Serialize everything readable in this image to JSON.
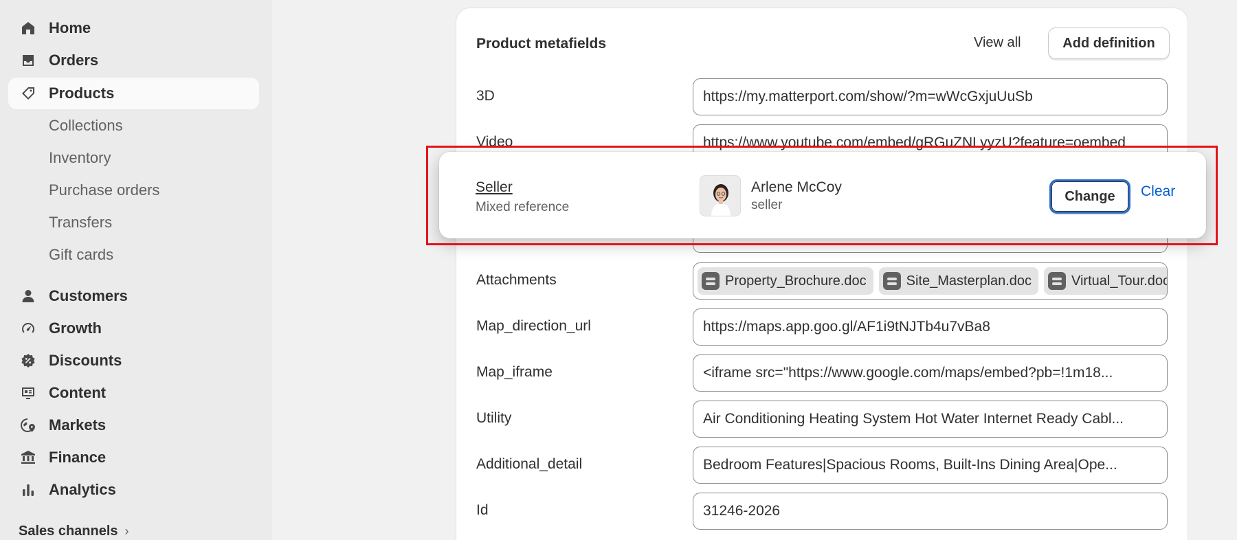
{
  "sidebar": {
    "items": [
      {
        "label": "Home",
        "icon": "home-icon"
      },
      {
        "label": "Orders",
        "icon": "inbox-icon"
      },
      {
        "label": "Products",
        "icon": "tag-icon",
        "active": true
      },
      {
        "label": "Collections"
      },
      {
        "label": "Inventory"
      },
      {
        "label": "Purchase orders"
      },
      {
        "label": "Transfers"
      },
      {
        "label": "Gift cards"
      },
      {
        "label": "Customers",
        "icon": "person-icon"
      },
      {
        "label": "Growth",
        "icon": "gauge-icon"
      },
      {
        "label": "Discounts",
        "icon": "discount-icon"
      },
      {
        "label": "Content",
        "icon": "content-icon"
      },
      {
        "label": "Markets",
        "icon": "globe-icon"
      },
      {
        "label": "Finance",
        "icon": "bank-icon"
      },
      {
        "label": "Analytics",
        "icon": "bar-chart-icon"
      }
    ],
    "sales_channels": "Sales channels"
  },
  "metafields": {
    "title": "Product metafields",
    "view_all": "View all",
    "add_definition": "Add definition",
    "fields": [
      {
        "label": "3D",
        "value": "https://my.matterport.com/show/?m=wWcGxjuUuSb"
      },
      {
        "label": "Video",
        "value": "https://www.youtube.com/embed/gRGuZNLyyzU?feature=oembed"
      },
      {
        "label": "Attachments",
        "attachments": [
          "Property_Brochure.doc",
          "Site_Masterplan.doc",
          "Virtual_Tour.doc"
        ]
      },
      {
        "label": "Map_direction_url",
        "value": "https://maps.app.goo.gl/AF1i9tNJTb4u7vBa8"
      },
      {
        "label": "Map_iframe",
        "value": "<iframe src=\"https://www.google.com/maps/embed?pb=!1m18..."
      },
      {
        "label": "Utility",
        "value": "Air Conditioning Heating System Hot Water Internet Ready Cabl..."
      },
      {
        "label": "Additional_detail",
        "value": "Bedroom Features|Spacious Rooms, Built-Ins Dining Area|Ope..."
      },
      {
        "label": "Id",
        "value": "31246-2026"
      }
    ]
  },
  "seller_popup": {
    "label": "Seller",
    "type": "Mixed reference",
    "name": "Arlene McCoy",
    "role": "seller",
    "change": "Change",
    "clear": "Clear",
    "highlight_color": "#e2141b"
  }
}
